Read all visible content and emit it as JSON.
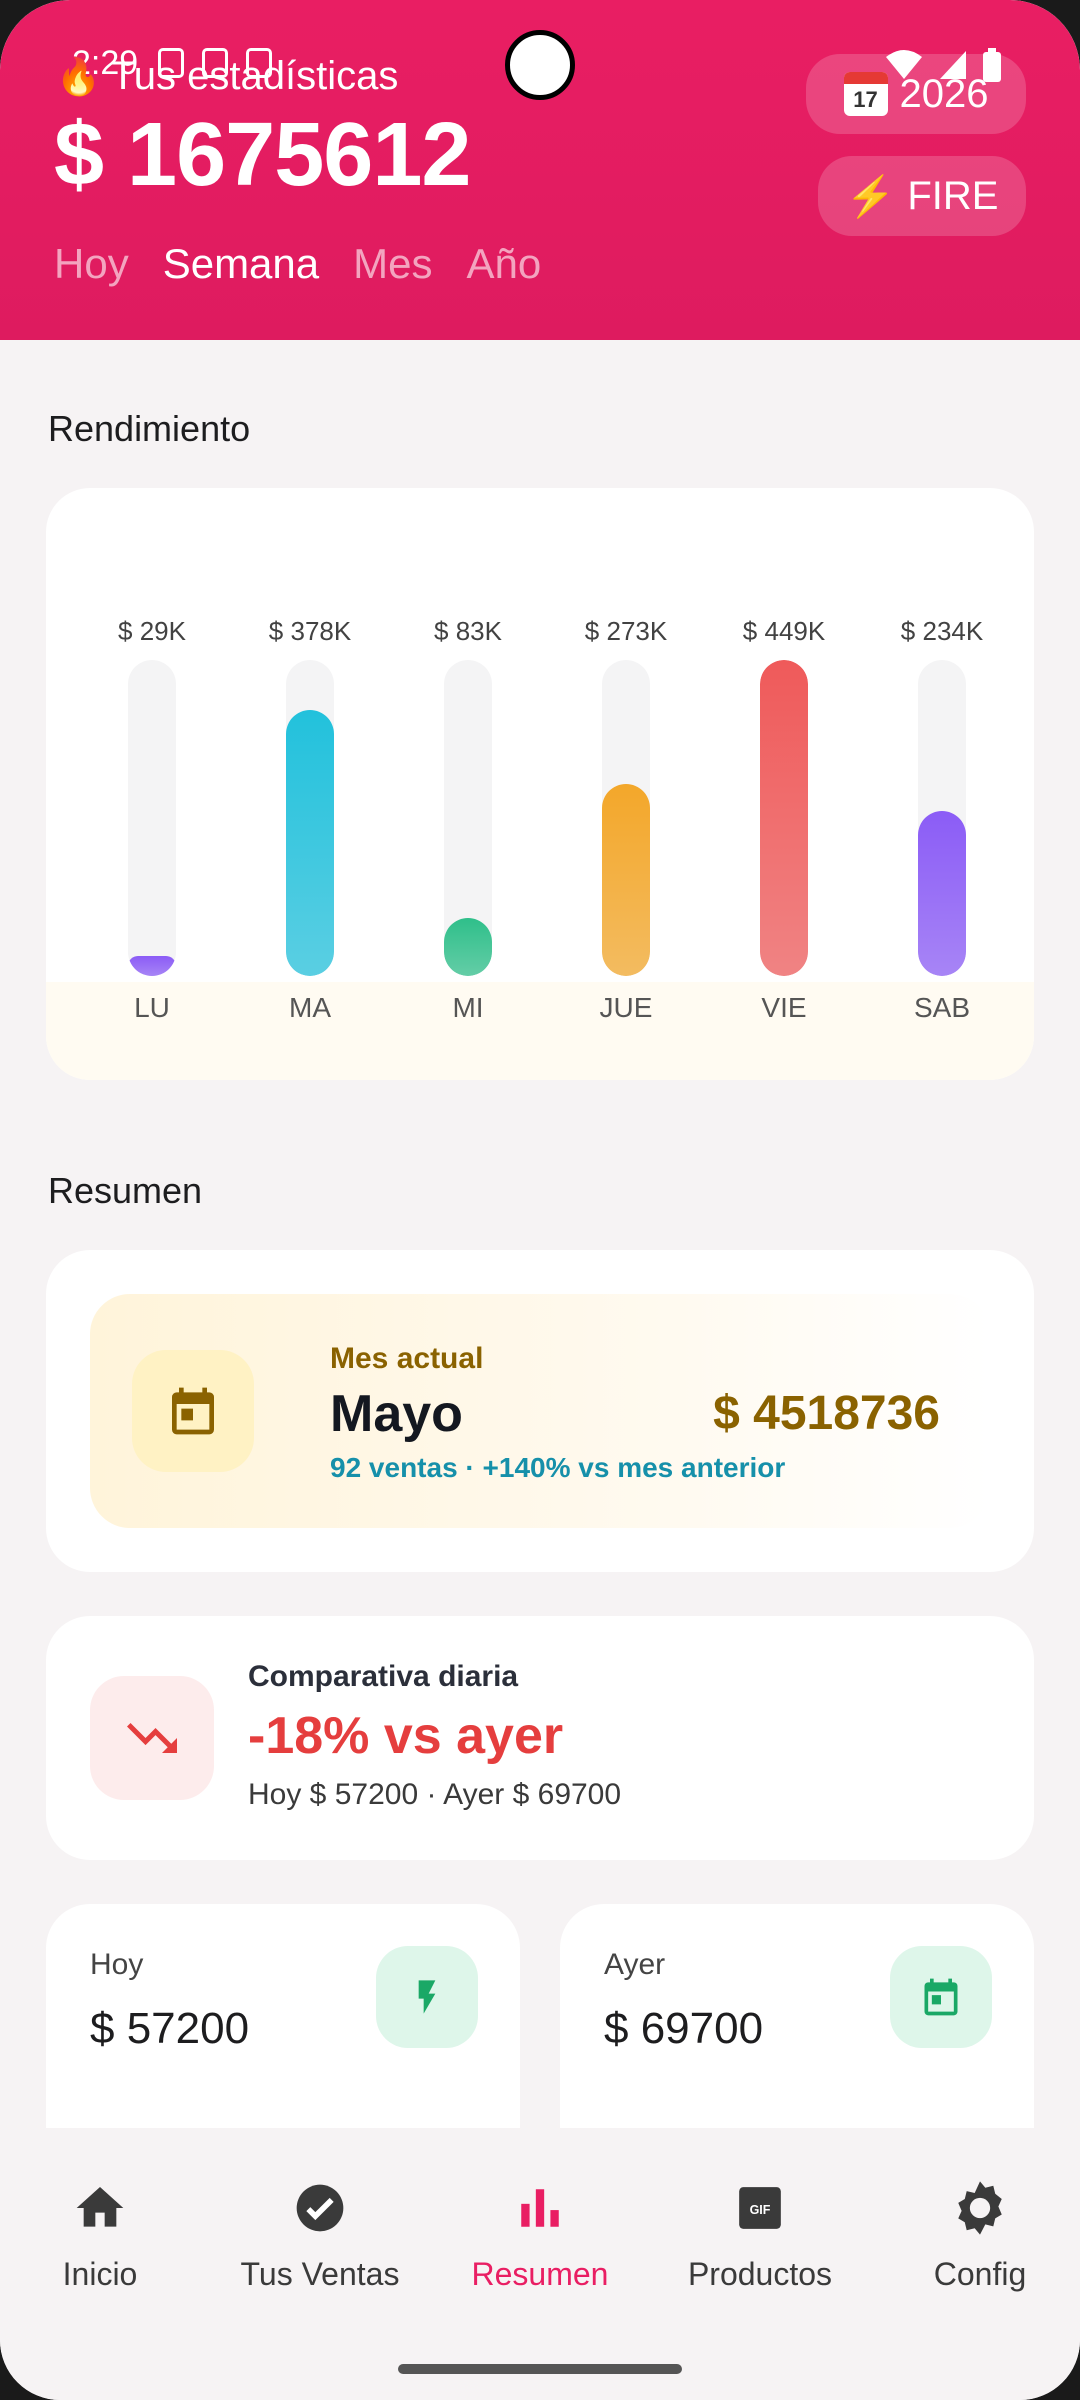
{
  "status_bar": {
    "time": "2:29"
  },
  "header": {
    "title": "Tus estadísticas",
    "total": "$ 1675612",
    "year_badge": {
      "month": "July",
      "day": "17",
      "label": "2026"
    },
    "fire_badge": {
      "icon": "⚡",
      "label": "FIRE"
    },
    "period_tabs": [
      {
        "label": "Hoy",
        "active": false
      },
      {
        "label": "Semana",
        "active": true
      },
      {
        "label": "Mes",
        "active": false
      },
      {
        "label": "Año",
        "active": false
      }
    ]
  },
  "performance": {
    "title": "Rendimiento"
  },
  "chart_data": {
    "type": "bar",
    "categories": [
      "LU",
      "MA",
      "MI",
      "JUE",
      "VIE",
      "SAB"
    ],
    "values": [
      29000,
      378000,
      83000,
      273000,
      449000,
      234000
    ],
    "value_labels": [
      "$ 29K",
      "$ 378K",
      "$ 83K",
      "$ 273K",
      "$ 449K",
      "$ 234K"
    ],
    "colors": [
      "#8b5cf6",
      "#22c1dc",
      "#2fbf8a",
      "#f3a72a",
      "#ef5a5a",
      "#8b5cf6"
    ],
    "ylim": [
      0,
      449000
    ],
    "grid": false
  },
  "summary": {
    "title": "Resumen",
    "month": {
      "label": "Mes actual",
      "name": "Mayo",
      "amount": "$ 4518736",
      "subtitle": "92 ventas · +140% vs mes anterior"
    },
    "compare": {
      "label": "Comparativa diaria",
      "main": "-18% vs ayer",
      "sub": "Hoy $ 57200 · Ayer $ 69700"
    },
    "today": {
      "label": "Hoy",
      "value": "$ 57200"
    },
    "yesterday": {
      "label": "Ayer",
      "value": "$ 69700"
    }
  },
  "nav": {
    "items": [
      {
        "label": "Inicio",
        "icon": "home-icon"
      },
      {
        "label": "Tus Ventas",
        "icon": "check-circle-icon"
      },
      {
        "label": "Resumen",
        "icon": "bar-chart-icon",
        "active": true
      },
      {
        "label": "Productos",
        "icon": "gif-icon"
      },
      {
        "label": "Config",
        "icon": "gear-icon"
      }
    ]
  },
  "colors": {
    "primary": "#e91e63",
    "accent_gold": "#8a6200",
    "negative": "#e53e3e",
    "teal": "#1690aa"
  }
}
